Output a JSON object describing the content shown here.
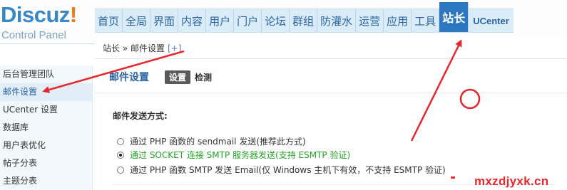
{
  "logo": {
    "brand_main": "Discuz",
    "brand_bang": "!",
    "subtitle": "Control Panel"
  },
  "nav": {
    "items": [
      {
        "label": "首页"
      },
      {
        "label": "全局"
      },
      {
        "label": "界面"
      },
      {
        "label": "内容"
      },
      {
        "label": "用户"
      },
      {
        "label": "门户"
      },
      {
        "label": "论坛"
      },
      {
        "label": "群组"
      },
      {
        "label": "防灌水"
      },
      {
        "label": "运营"
      },
      {
        "label": "应用"
      },
      {
        "label": "工具"
      },
      {
        "label": "站长"
      },
      {
        "label": "UCenter"
      }
    ],
    "active": "站长"
  },
  "breadcrumb": {
    "text": "站长 » 邮件设置",
    "add": "[+]"
  },
  "sidebar": {
    "items": [
      {
        "label": "后台管理团队"
      },
      {
        "label": "邮件设置"
      },
      {
        "label": "UCenter 设置"
      },
      {
        "label": "数据库"
      },
      {
        "label": "用户表优化"
      },
      {
        "label": "帖子分表"
      },
      {
        "label": "主题分表"
      }
    ],
    "active": "邮件设置"
  },
  "main": {
    "title": "邮件设置",
    "tabs": [
      {
        "label": "设置",
        "active": true
      },
      {
        "label": "检测",
        "active": false
      }
    ],
    "section_label": "邮件发送方式:",
    "options": [
      {
        "label": "通过 PHP 函数的 sendmail 发送(推荐此方式)",
        "checked": false
      },
      {
        "label": "通过 SOCKET 连接 SMTP 服务器发送(支持 ESMTP 验证)",
        "checked": true
      },
      {
        "label": "通过 PHP 函数 SMTP 发送 Email(仅 Windows 主机下有效，不支持 ESMTP 验证)",
        "checked": false
      }
    ]
  },
  "watermark": {
    "text": "mxzdjyxk.cn"
  },
  "colors": {
    "accent": "#2c77c2",
    "annotation": "#e8262b",
    "selected_option": "#22a524",
    "nav_bg": "#d9ecf8"
  }
}
